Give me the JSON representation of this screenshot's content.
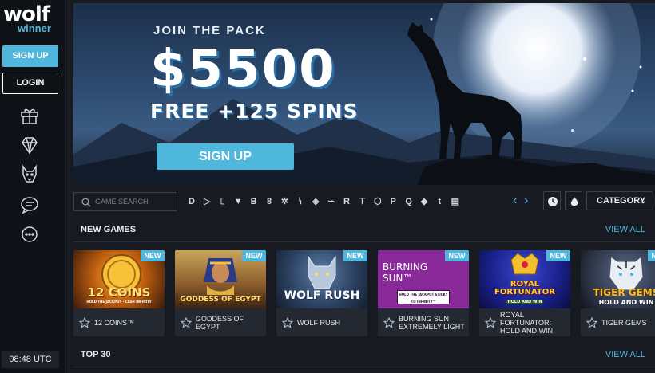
{
  "brand": {
    "name": "wolf",
    "sub": "winner"
  },
  "sidebar": {
    "signup_label": "SIGN UP",
    "login_label": "LOGIN",
    "icons": [
      "gift-icon",
      "diamond-icon",
      "wolf-icon",
      "chat-icon",
      "more-icon"
    ],
    "clock": "08:48 UTC"
  },
  "banner": {
    "join_text": "JOIN THE PACK",
    "amount": "$5500",
    "free_spins": "FREE +125 SPINS",
    "signup_label": "SIGN UP"
  },
  "toolbar": {
    "search_placeholder": "GAME SEARCH",
    "providers": [
      "D",
      "▷",
      "⌷",
      "▼",
      "B",
      "8",
      "✲",
      "ꝇ",
      "◈",
      "∽",
      "R",
      "⊤",
      "⬡",
      "P",
      "Q",
      "◆",
      "t",
      "▤"
    ],
    "category_label": "CATEGORY"
  },
  "new_games": {
    "title": "NEW GAMES",
    "view_all": "VIEW ALL",
    "badge": "NEW",
    "items": [
      {
        "name": "12 COINS™",
        "art": "12 COINS",
        "art_sub": "HOLD THE JACKPOT · CASH INFINITY"
      },
      {
        "name": "GODDESS OF EGYPT",
        "art": "GODDESS OF EGYPT",
        "art_sub": ""
      },
      {
        "name": "WOLF RUSH",
        "art": "WOLF RUSH",
        "art_sub": ""
      },
      {
        "name": "BURNING SUN EXTREMELY LIGHT",
        "art": "BURNING SUN™",
        "art_sub": "HOLD THE JACKPOT STICKY TO INFINITY™"
      },
      {
        "name": "ROYAL FORTUNATOR: HOLD AND WIN",
        "art": "ROYAL FORTUNATOR",
        "art_sub": "HOLD AND WIN"
      },
      {
        "name": "TIGER GEMS",
        "art": "TIGER GEMS",
        "art_sub": "HOLD AND WIN"
      }
    ]
  },
  "top30": {
    "title": "TOP 30",
    "view_all": "VIEW ALL"
  },
  "colors": {
    "accent": "#4fb6dc",
    "bg": "#171a21",
    "sidebar": "#0f1217"
  }
}
